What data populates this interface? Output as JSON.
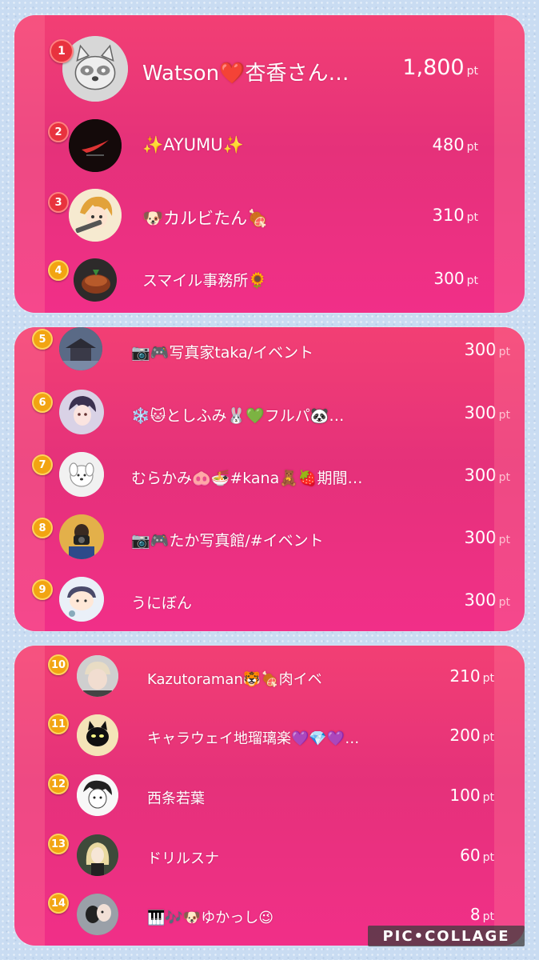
{
  "unit": "pt",
  "watermark": "PIC•COLLAGE",
  "entries": [
    {
      "rank": "1",
      "name": "Watson❤️杏香さん…",
      "points": "1,800",
      "avatar": "raccoon-sketch-avatar"
    },
    {
      "rank": "2",
      "name": "✨AYUMU✨",
      "points": "480",
      "avatar": "dark-logo-avatar"
    },
    {
      "rank": "3",
      "name": "🐶カルビたん🍖",
      "points": "310",
      "avatar": "anime-girl-avatar"
    },
    {
      "rank": "4",
      "name": "スマイル事務所🌻",
      "points": "300",
      "avatar": "cake-photo-avatar"
    },
    {
      "rank": "5",
      "name": "📷🎮写真家taka/イベント",
      "points": "300",
      "avatar": "temple-photo-avatar"
    },
    {
      "rank": "6",
      "name": "❄️🐱としふみ🐰💚フルパ🐼…",
      "points": "300",
      "avatar": "anime-boy-avatar"
    },
    {
      "rank": "7",
      "name": "むらかみ🐽🍜#kana🧸🍓期間…",
      "points": "300",
      "avatar": "white-character-avatar"
    },
    {
      "rank": "8",
      "name": "📷🎮たか写真館/#イベント",
      "points": "300",
      "avatar": "photographer-avatar"
    },
    {
      "rank": "9",
      "name": "うにぼん",
      "points": "300",
      "avatar": "cartoon-face-avatar"
    },
    {
      "rank": "10",
      "name": "Kazutoraman🐯🍖肉イベ",
      "points": "210",
      "avatar": "blond-person-avatar"
    },
    {
      "rank": "11",
      "name": "キャラウェイ地瑠璃楽💜💎💜…",
      "points": "200",
      "avatar": "black-cat-avatar"
    },
    {
      "rank": "12",
      "name": "西条若葉",
      "points": "100",
      "avatar": "sketch-boy-avatar"
    },
    {
      "rank": "13",
      "name": "ドリルスナ",
      "points": "60",
      "avatar": "blonde-girl-avatar"
    },
    {
      "rank": "14",
      "name": "🎹🎶🐶ゆかっし😉",
      "points": "8",
      "avatar": "selfie-avatar"
    }
  ],
  "colors": {
    "panel": "#e8327a",
    "rank_red": "#e8323e",
    "rank_gold": "#f2a412",
    "background": "#c9dcf2"
  }
}
